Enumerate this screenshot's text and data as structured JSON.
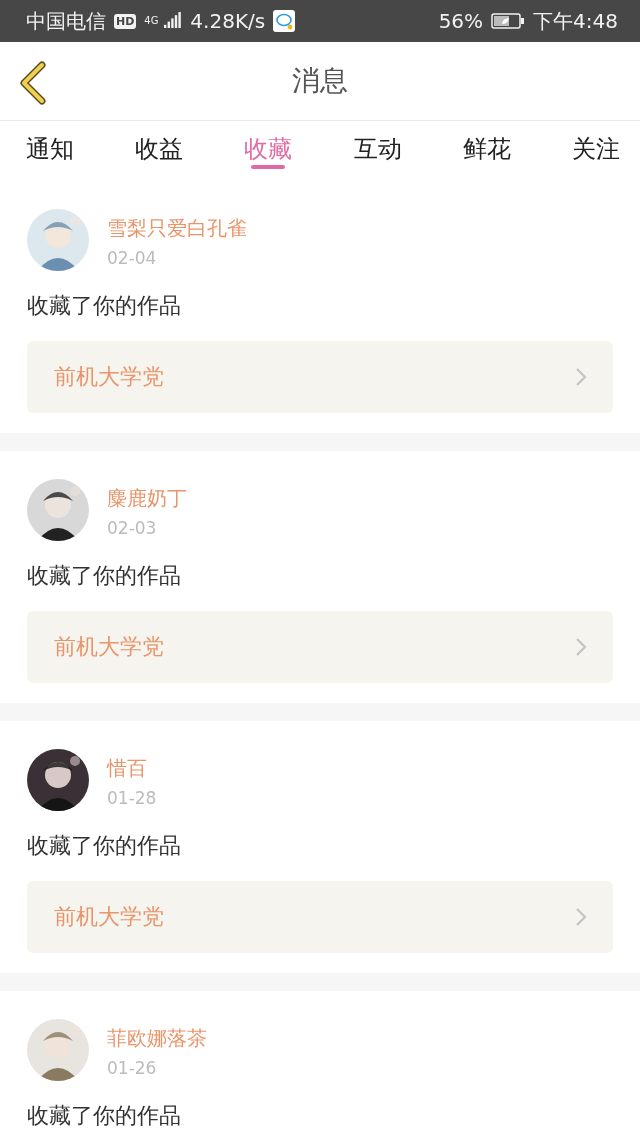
{
  "status_bar": {
    "carrier": "中国电信",
    "hd": "HD",
    "network": "4G",
    "speed": "4.28K/s",
    "battery": "56%",
    "time": "下午4:48"
  },
  "header": {
    "title": "消息"
  },
  "tabs": [
    {
      "label": "通知",
      "selected": false
    },
    {
      "label": "收益",
      "selected": false
    },
    {
      "label": "收藏",
      "selected": true
    },
    {
      "label": "互动",
      "selected": false
    },
    {
      "label": "鲜花",
      "selected": false
    },
    {
      "label": "关注",
      "selected": false
    }
  ],
  "messages": [
    {
      "user": "雪梨只爱白孔雀",
      "date": "02-04",
      "text": "收藏了你的作品",
      "work": "前机大学党"
    },
    {
      "user": "麋鹿奶丁",
      "date": "02-03",
      "text": "收藏了你的作品",
      "work": "前机大学党"
    },
    {
      "user": "惜百",
      "date": "01-28",
      "text": "收藏了你的作品",
      "work": "前机大学党"
    },
    {
      "user": "菲欧娜落茶",
      "date": "01-26",
      "text": "收藏了你的作品"
    }
  ]
}
